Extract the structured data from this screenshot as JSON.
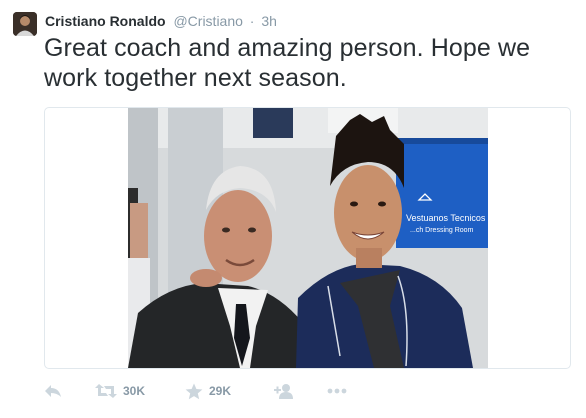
{
  "tweet": {
    "author_name": "Cristiano Ronaldo",
    "author_handle": "@Cristiano",
    "separator": "·",
    "timestamp": "3h",
    "text": "Great coach and amazing person. Hope we work together next season.",
    "media": {
      "sign_line1": "Vestuanos Tecnicos",
      "sign_line2": "...ch Dressing Room"
    },
    "actions": {
      "reply_icon": "reply-icon",
      "retweet_icon": "retweet-icon",
      "retweet_count": "30K",
      "favorite_icon": "star-icon",
      "favorite_count": "29K",
      "follow_icon": "add-user-icon",
      "more_icon": "more-dots-icon"
    }
  },
  "colors": {
    "name_text": "#292f33",
    "muted_text": "#8899a6",
    "icon_gray": "#ccd6dd",
    "border": "#e1e8ed"
  }
}
